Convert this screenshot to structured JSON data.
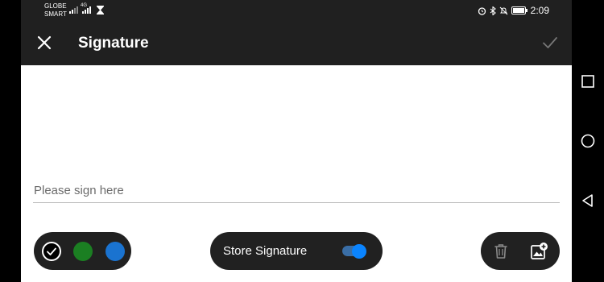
{
  "status_bar": {
    "carrier_1": "GLOBE",
    "carrier_2": "SMART",
    "net_type": "4G",
    "time": "2:09"
  },
  "app_bar": {
    "title": "Signature"
  },
  "canvas": {
    "placeholder": "Please sign here"
  },
  "colors": [
    {
      "name": "black",
      "hex": "#000000",
      "selected": true
    },
    {
      "name": "green",
      "hex": "#1b7f22",
      "selected": false
    },
    {
      "name": "blue",
      "hex": "#1a73d0",
      "selected": false
    }
  ],
  "store": {
    "label": "Store Signature",
    "enabled": true
  },
  "accent_color": "#0a84ff"
}
